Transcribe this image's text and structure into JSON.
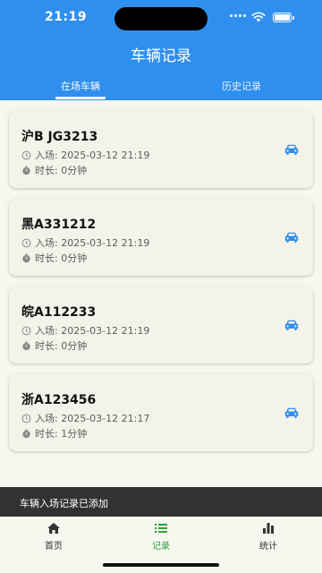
{
  "status_bar": {
    "time": "21:19"
  },
  "header": {
    "title": "车辆记录",
    "tabs": [
      {
        "label": "在场车辆"
      },
      {
        "label": "历史记录"
      }
    ],
    "active_tab": "在场车辆",
    "accent_color": "#2f8fee"
  },
  "vehicles": [
    {
      "plate": "沪B JG3213",
      "entry": "入场: 2025-03-12 21:19",
      "duration": "时长: 0分钟"
    },
    {
      "plate": "黑A331212",
      "entry": "入场: 2025-03-12 21:19",
      "duration": "时长: 0分钟"
    },
    {
      "plate": "皖A112233",
      "entry": "入场: 2025-03-12 21:19",
      "duration": "时长: 0分钟"
    },
    {
      "plate": "浙A123456",
      "entry": "入场: 2025-03-12 21:17",
      "duration": "时长: 1分钟"
    }
  ],
  "toast": {
    "message": "车辆入场记录已添加"
  },
  "bottom_nav": {
    "items": [
      {
        "label": "首页",
        "icon": "home-icon"
      },
      {
        "label": "记录",
        "icon": "list-icon"
      },
      {
        "label": "统计",
        "icon": "bar-chart-icon"
      }
    ],
    "active": "记录",
    "active_color": "#31a03a"
  },
  "icons": {
    "entry": "clock-icon",
    "duration": "timer-icon",
    "vehicle": "car-icon"
  }
}
